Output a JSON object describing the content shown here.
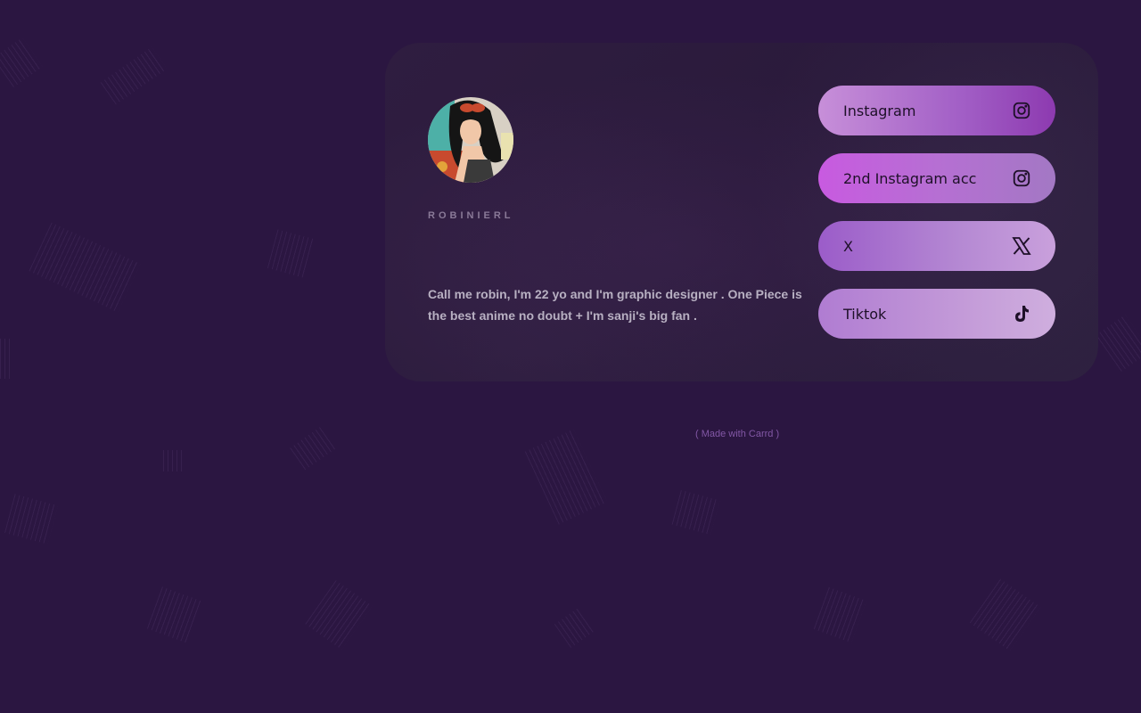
{
  "profile": {
    "username": "ROBINIERL",
    "bio": "Call me robin, I'm 22 yo and I'm graphic designer . One Piece is the best anime no doubt + I'm sanji's big fan ."
  },
  "links": [
    {
      "label": "Instagram",
      "icon": "instagram-icon"
    },
    {
      "label": "2nd Instagram acc",
      "icon": "instagram-icon"
    },
    {
      "label": "X",
      "icon": "x-logo-icon"
    },
    {
      "label": "Tiktok",
      "icon": "tiktok-icon"
    }
  ],
  "footer": {
    "credit": "( Made with Carrd )"
  },
  "colors": {
    "background": "#2b1641",
    "card": "#2d1d3e",
    "footer_text": "#8257a5"
  }
}
